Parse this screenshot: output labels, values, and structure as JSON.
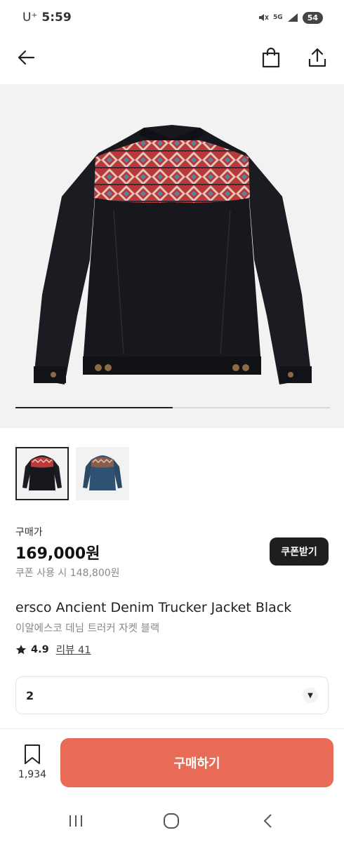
{
  "status_bar": {
    "carrier": "U⁺",
    "time": "5:59",
    "network": "5G",
    "battery": "54"
  },
  "nav": {
    "back_icon": "arrow-left-icon",
    "bag_icon": "shopping-bag-icon",
    "share_icon": "share-icon"
  },
  "gallery": {
    "progress": 0.5
  },
  "thumbnails": [
    {
      "name": "black-jacket",
      "active": true
    },
    {
      "name": "blue-jacket",
      "active": false
    }
  ],
  "price": {
    "label": "구매가",
    "amount": "169,000원",
    "coupon_note": "쿠폰 사용 시 148,800원",
    "coupon_button": "쿠폰받기"
  },
  "product": {
    "title": "ersco Ancient Denim Trucker Jacket Black",
    "subtitle": "이알에스코 데님 트러커 자켓 블랙",
    "rating": "4.9",
    "review_label": "리뷰 41"
  },
  "option": {
    "selected": "2"
  },
  "bottom": {
    "bookmark_count": "1,934",
    "buy_label": "구매하기"
  },
  "colors": {
    "accent": "#e86b58",
    "dark_button": "#1e1e1e"
  }
}
